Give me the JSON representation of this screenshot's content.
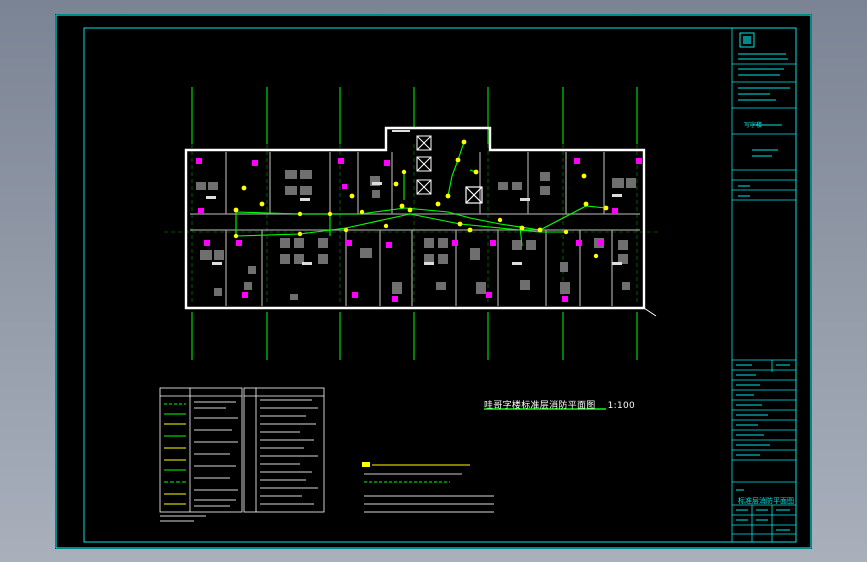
{
  "drawing": {
    "title": "哇哥字楼标准层消防平面图",
    "scale": "1:100"
  },
  "title_block": {
    "project_caption": "标准层消防平面图",
    "project_name": "写字楼"
  },
  "colors": {
    "frame": "#00e5e5",
    "walls": "#ffffff",
    "axis": "#00ff00",
    "pipe": "#00ff00",
    "equipment": "#ffff00",
    "furniture": "#ff00ff",
    "background": "#000000"
  },
  "icons": [
    "logo-icon",
    "stairwell-icon",
    "exhaust-fan-icon",
    "sprinkler-icon"
  ]
}
